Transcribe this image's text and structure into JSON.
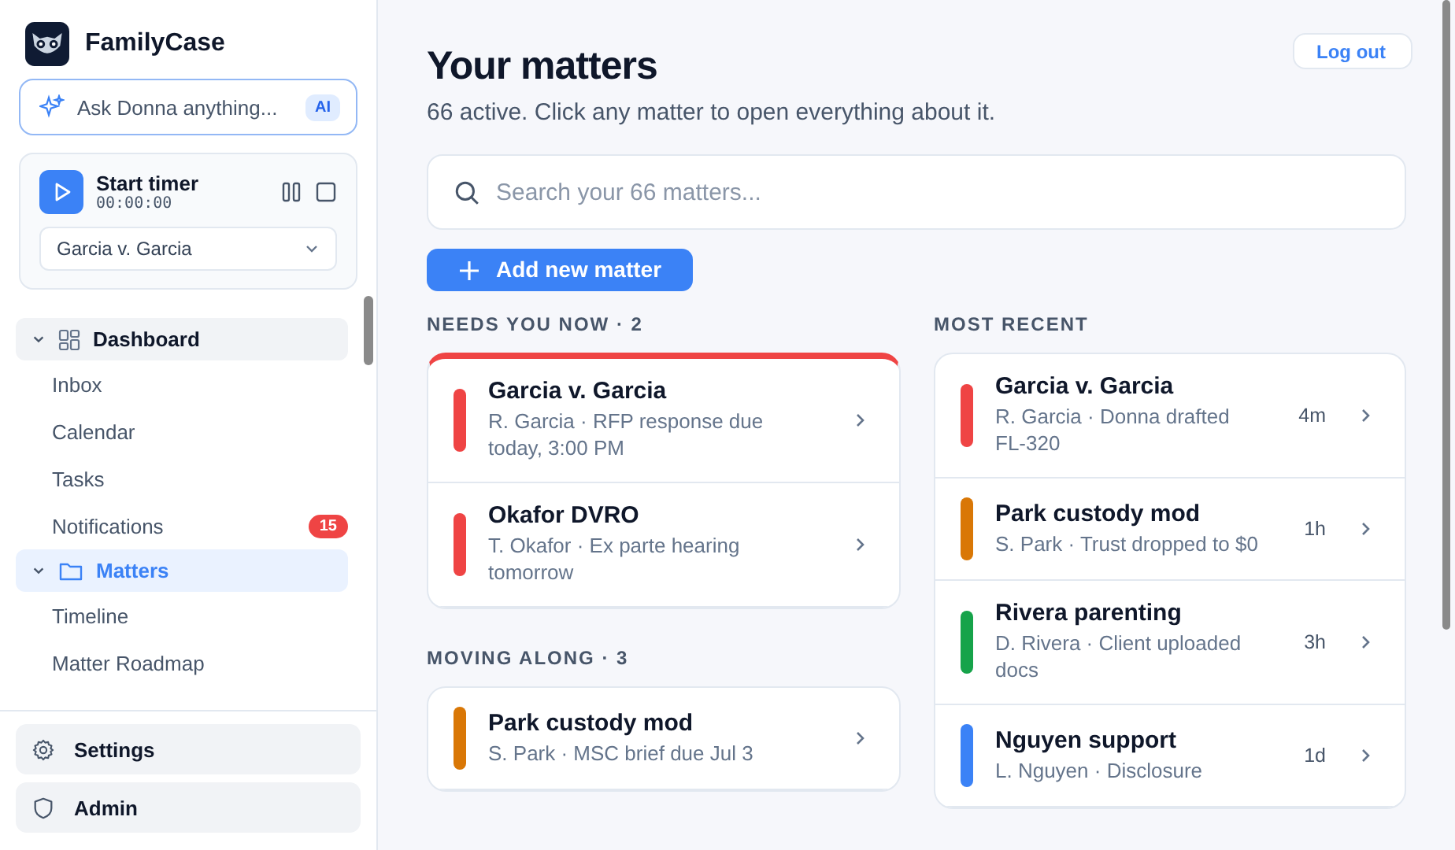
{
  "brand": {
    "name": "FamilyCase"
  },
  "ask": {
    "placeholder": "Ask Donna anything...",
    "badge": "AI"
  },
  "timer": {
    "title": "Start timer",
    "time": "00:00:00",
    "matter": "Garcia v. Garcia"
  },
  "nav": [
    {
      "label": "Dashboard",
      "expanded": true,
      "selected": false,
      "children": [
        {
          "label": "Inbox"
        },
        {
          "label": "Calendar"
        },
        {
          "label": "Tasks"
        },
        {
          "label": "Notifications",
          "badge": "15"
        }
      ]
    },
    {
      "label": "Matters",
      "expanded": true,
      "selected": true,
      "children": [
        {
          "label": "Timeline"
        },
        {
          "label": "Matter Roadmap"
        }
      ]
    }
  ],
  "footer_nav": [
    {
      "label": "Settings"
    },
    {
      "label": "Admin"
    }
  ],
  "header": {
    "title": "Your matters",
    "subtitle": "66 active. Click any matter to open everything about it.",
    "logout": "Log out"
  },
  "search": {
    "placeholder": "Search your 66 matters..."
  },
  "add_button": "Add new matter",
  "left_sections": [
    {
      "title": "NEEDS YOU NOW · 2",
      "kind": "urgent",
      "items": [
        {
          "name": "Garcia v. Garcia",
          "detail": "R. Garcia · RFP response due today, 3:00 PM",
          "color": "#ef4444"
        },
        {
          "name": "Okafor DVRO",
          "detail": "T. Okafor · Ex parte hearing tomorrow",
          "color": "#ef4444"
        }
      ]
    },
    {
      "title": "MOVING ALONG · 3",
      "kind": "normal",
      "items": [
        {
          "name": "Park custody mod",
          "detail": "S. Park · MSC brief due Jul 3",
          "color": "#d97706"
        }
      ]
    }
  ],
  "recent": {
    "title": "MOST RECENT",
    "items": [
      {
        "name": "Garcia v. Garcia",
        "detail": "R. Garcia · Donna drafted FL-320",
        "time": "4m",
        "color": "#ef4444"
      },
      {
        "name": "Park custody mod",
        "detail": "S. Park · Trust dropped to $0",
        "time": "1h",
        "color": "#d97706"
      },
      {
        "name": "Rivera parenting",
        "detail": "D. Rivera · Client uploaded docs",
        "time": "3h",
        "color": "#16a34a"
      },
      {
        "name": "Nguyen support",
        "detail": "L. Nguyen · Disclosure",
        "time": "1d",
        "color": "#3b82f6"
      }
    ]
  }
}
